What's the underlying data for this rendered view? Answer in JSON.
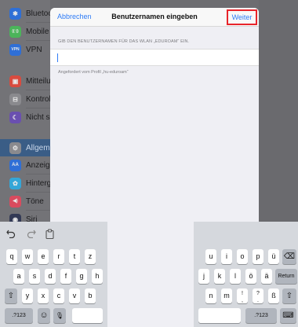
{
  "sidebar": {
    "items": [
      {
        "label": "Bluetoo",
        "icon": "bluetooth-icon",
        "icon_glyph": "✱",
        "color": "#2f6fd6"
      },
      {
        "label": "Mobile",
        "icon": "cellular-icon",
        "icon_glyph": "((·))",
        "color": "#4bb45a"
      },
      {
        "label": "VPN",
        "icon": "vpn-icon",
        "icon_glyph": "VPN",
        "color": "#2f6fd6"
      },
      {
        "label": "Mitteilu",
        "icon": "notifications-icon",
        "icon_glyph": "▣",
        "color": "#d94b3f"
      },
      {
        "label": "Kontrol",
        "icon": "control-center-icon",
        "icon_glyph": "⊟",
        "color": "#8a8a8e"
      },
      {
        "label": "Nicht s",
        "icon": "do-not-disturb-icon",
        "icon_glyph": "☾",
        "color": "#6a4fb0"
      },
      {
        "label": "Allgeme",
        "icon": "gear-icon",
        "icon_glyph": "⚙",
        "color": "#8a8a8e"
      },
      {
        "label": "Anzeig",
        "icon": "display-icon",
        "icon_glyph": "AA",
        "color": "#2f6fd6"
      },
      {
        "label": "Hinterg",
        "icon": "wallpaper-icon",
        "icon_glyph": "✿",
        "color": "#34a6d8"
      },
      {
        "label": "Töne",
        "icon": "sounds-icon",
        "icon_glyph": "◀)",
        "color": "#d94b5e"
      },
      {
        "label": "Siri",
        "icon": "siri-icon",
        "icon_glyph": "◉",
        "color": "#333a55"
      }
    ]
  },
  "dialog": {
    "cancel_label": "Abbrechen",
    "title": "Benutzernamen eingeben",
    "next_label": "Weiter",
    "section_header": "GIB DEN BENUTZERNAMEN FÜR DAS WLAN „EDUROAM“ EIN.",
    "username_value": "",
    "footer_note": "Angefordert vom Profil „hu-eduroam“"
  },
  "keyboard": {
    "undo_icon": "undo-icon",
    "redo_icon": "redo-icon",
    "paste_icon": "paste-icon",
    "left_row1": [
      "q",
      "w",
      "e",
      "r",
      "t",
      "z"
    ],
    "left_row2": [
      "a",
      "s",
      "d",
      "f",
      "g",
      "h"
    ],
    "left_row3": [
      "y",
      "x",
      "c",
      "v",
      "b"
    ],
    "right_row1": [
      "u",
      "i",
      "o",
      "p",
      "ü"
    ],
    "right_row2": [
      "j",
      "k",
      "l",
      "ö",
      "ä"
    ],
    "right_row3": [
      "n",
      "m",
      "!",
      "?",
      "ß"
    ],
    "shift_glyph": "⇧",
    "backspace_glyph": "⌫",
    "return_label": "Return",
    "numbers_label": ".?123",
    "emoji_glyph": "☺",
    "mic_glyph": "🎙",
    "hide_keyboard_glyph": "⌨",
    "exclamation_sub": ",",
    "question_sub": "."
  },
  "colors": {
    "accent": "#2f7cf6",
    "highlight_box": "#e8242b"
  }
}
